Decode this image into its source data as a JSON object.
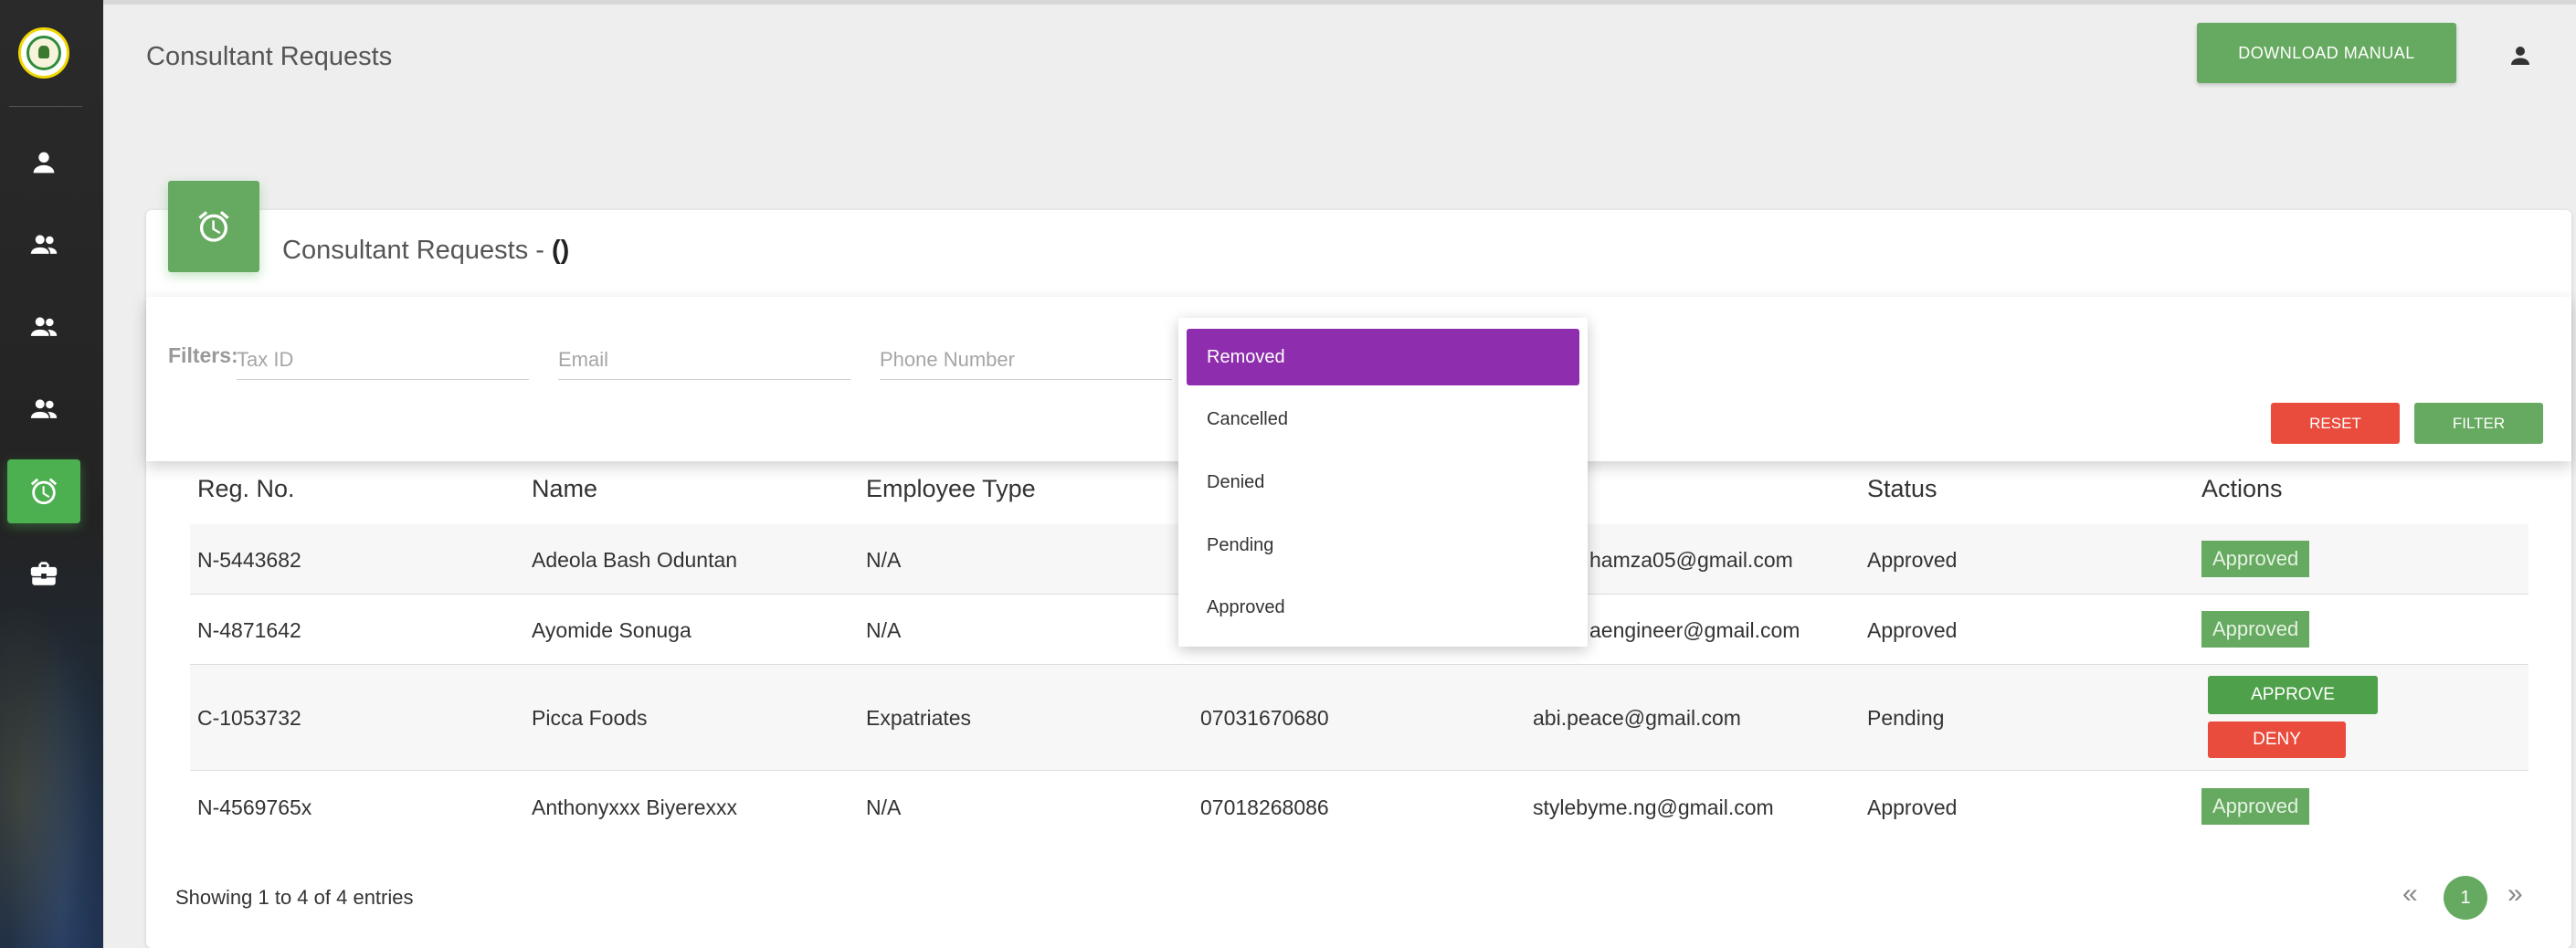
{
  "header": {
    "title": "Consultant Requests",
    "download_label": "DOWNLOAD MANUAL"
  },
  "sidebar": {
    "items": [
      {
        "icon": "person-icon"
      },
      {
        "icon": "people-icon"
      },
      {
        "icon": "people-icon"
      },
      {
        "icon": "people-icon"
      },
      {
        "icon": "alarm-clock-icon",
        "active": true
      },
      {
        "icon": "briefcase-icon"
      }
    ]
  },
  "card": {
    "title": "Consultant Requests - ",
    "count": "()"
  },
  "filters": {
    "label": "Filters:",
    "tax_id_placeholder": "Tax ID",
    "email_placeholder": "Email",
    "phone_placeholder": "Phone Number",
    "reset_label": "RESET",
    "filter_label": "FILTER"
  },
  "dropdown": {
    "options": [
      "Removed",
      "Cancelled",
      "Denied",
      "Pending",
      "Approved"
    ],
    "selected": "Removed"
  },
  "table": {
    "headers": [
      "Reg. No.",
      "Name",
      "Employee Type",
      "",
      "l",
      "Status",
      "Actions"
    ],
    "rows": [
      {
        "reg": "N-5443682",
        "name": "Adeola Bash Oduntan",
        "type": "N/A",
        "phone": "",
        "email": "hamza05@gmail.com",
        "status": "Approved",
        "action": "Approved"
      },
      {
        "reg": "N-4871642",
        "name": "Ayomide Sonuga",
        "type": "N/A",
        "phone": "",
        "email": "aengineer@gmail.com",
        "status": "Approved",
        "action": "Approved"
      },
      {
        "reg": "C-1053732",
        "name": "Picca Foods",
        "type": "Expatriates",
        "phone": "07031670680",
        "email": "abi.peace@gmail.com",
        "status": "Pending",
        "approve_label": "APPROVE",
        "deny_label": "DENY"
      },
      {
        "reg": "N-4569765x",
        "name": "Anthonyxxx Biyerexxx",
        "type": "N/A",
        "phone": "07018268086",
        "email": "stylebyme.ng@gmail.com",
        "status": "Approved",
        "action": "Approved"
      }
    ]
  },
  "footer": {
    "showing": "Showing 1 to 4 of 4 entries",
    "prev": "«",
    "page": "1",
    "next": "»"
  },
  "colors": {
    "accent_green": "#66a960",
    "danger_red": "#e94b3c",
    "selected_purple": "#8e2eae"
  }
}
